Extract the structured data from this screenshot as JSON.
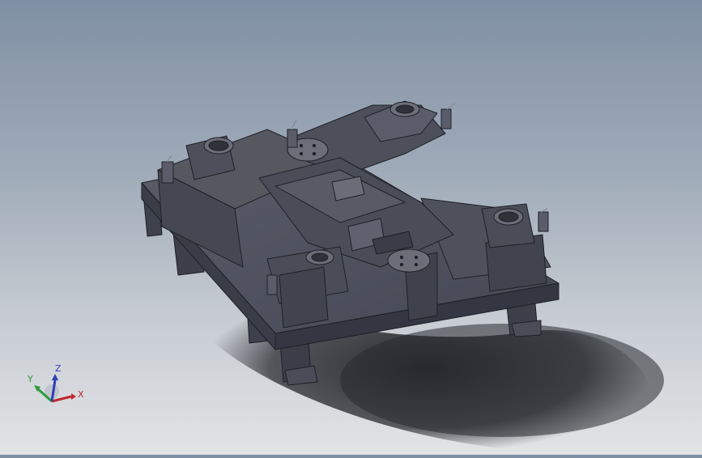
{
  "viewport": {
    "model": "bogie-frame-assembly",
    "colors": {
      "background_top": "#7f8fa3",
      "background_bottom": "#e2e3e5",
      "model_dark": "#3b3e48",
      "model_mid": "#4d505b",
      "model_light": "#5f626e",
      "edge": "#1e2026",
      "shadow": "#2a2c31"
    }
  },
  "triad": {
    "x_label": "X",
    "y_label": "Y",
    "z_label": "Z",
    "x_color": "#c0282d",
    "y_color": "#2f9a3c",
    "z_color": "#2b3fb5"
  }
}
